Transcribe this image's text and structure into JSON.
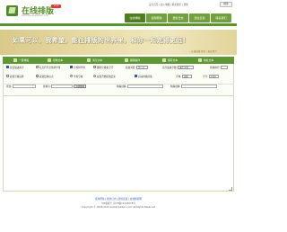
{
  "header": {
    "logo_title": "在线排版",
    "logo_subtitle": "www.zaixianpaiban.com",
    "logo_badge": "V2.0",
    "top_links": "设为首页 | 加入收藏 | 联系我们 | 帮助",
    "top_search": "搜索",
    "nav": [
      "在线排版",
      "使用帮助",
      "更新日志",
      "建议反馈",
      "联系我们"
    ]
  },
  "banner": {
    "text": "如果可以，我希望，能在排版的世界里，和你一起走得更远！",
    "note": "— 在线排版·我们一直在努力"
  },
  "toolbar": {
    "items": [
      "一键排版",
      "复制文本",
      "清空文本",
      "撤销操作",
      "保存文本",
      "恢复文本"
    ]
  },
  "options": {
    "row1": [
      {
        "type": "checkbox",
        "checked": true,
        "label": "段首缩进两字"
      },
      {
        "type": "checkbox",
        "checked": false,
        "label": "标点符号全角转半角"
      },
      {
        "type": "checkbox",
        "checked": true,
        "label": "全角转半角"
      },
      {
        "type": "checkbox",
        "checked": false,
        "label": "删除空格和空行"
      }
    ],
    "row1_selects": [
      {
        "label": "段落间距:",
        "value": "空一行"
      },
      {
        "label": "首行缩进字数:",
        "value": "两个字符"
      },
      {
        "label": "替换换行:",
        "value": ""
      }
    ],
    "row2": [
      {
        "type": "checkbox",
        "checked": false,
        "label": "段落空格后移"
      },
      {
        "type": "checkbox",
        "checked": false,
        "label": "段落结尾标点"
      },
      {
        "type": "radio",
        "checked": true,
        "label": "半角空格"
      },
      {
        "type": "radio",
        "checked": false,
        "label": "段落开始段落结束"
      },
      {
        "type": "checkbox",
        "checked": true,
        "label": "自动排版段落"
      }
    ],
    "row2_selects": [
      {
        "label": "字体:",
        "value": "宋体"
      },
      {
        "label": "字号:",
        "value": "12px"
      }
    ],
    "row3": {
      "find_label": "查找:",
      "find_placeholder": "",
      "replace_label": "替换为:",
      "replace_button": "全部替换",
      "extra_label": "特殊替换:",
      "extra2_label": "特殊替换:"
    }
  },
  "editor": {
    "placeholder": ""
  },
  "footer": {
    "line1": "使用帮助 | 更新日志 | 建议反馈 | 在线排版网",
    "line2": "ICP备案号 京ICP备12345678号",
    "line3": "Copyright © 2008-2013 zaixianpaiban.com All Rights Reserved"
  },
  "colors": {
    "brand_green": "#5f9734",
    "nav_green": "#6fa23b",
    "banner_gold": "#e8dca6"
  }
}
